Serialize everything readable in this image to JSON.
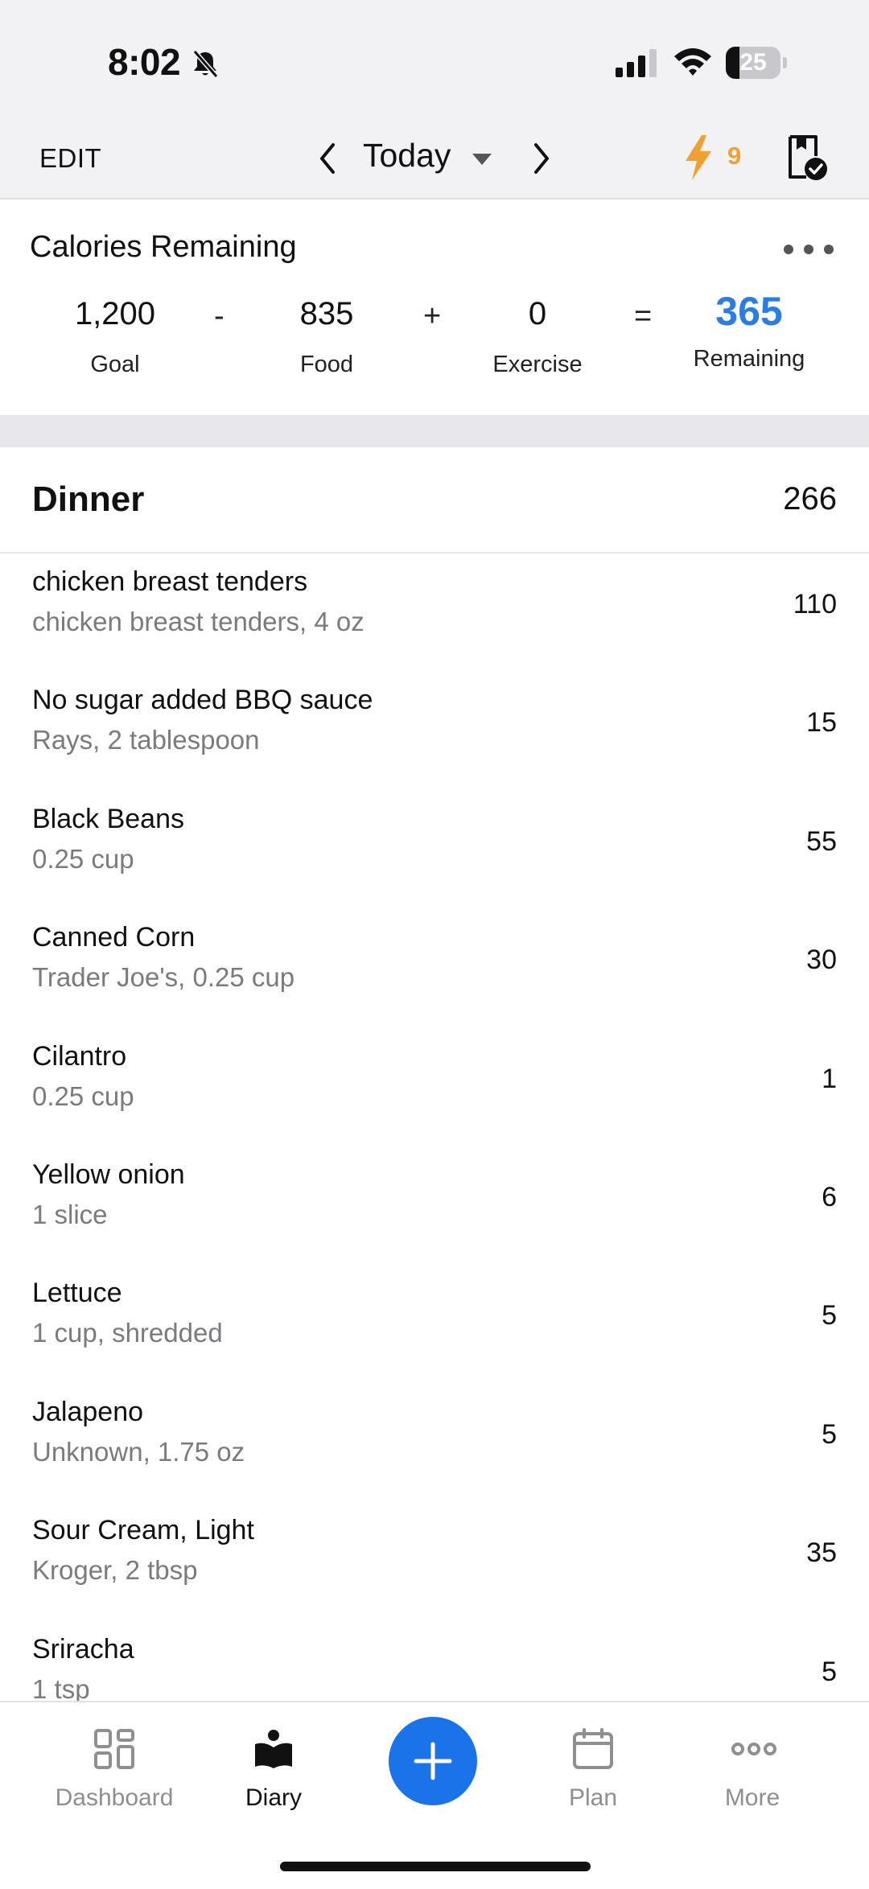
{
  "status_bar": {
    "time": "8:02",
    "battery": "25",
    "battery_fraction": 0.25
  },
  "nav": {
    "edit_label": "EDIT",
    "date_label": "Today",
    "streak_count": "9"
  },
  "calories": {
    "title": "Calories Remaining",
    "goal": "1,200",
    "goal_label": "Goal",
    "minus": "-",
    "food": "835",
    "food_label": "Food",
    "plus": "+",
    "exercise": "0",
    "exercise_label": "Exercise",
    "equals": "=",
    "remaining": "365",
    "remaining_label": "Remaining",
    "remaining_color": "#2a7de1"
  },
  "meal": {
    "name": "Dinner",
    "total": "266",
    "items": [
      {
        "name": "chicken breast tenders",
        "desc": "chicken breast tenders, 4 oz",
        "cals": "110"
      },
      {
        "name": "No sugar added BBQ sauce",
        "desc": "Rays, 2 tablespoon",
        "cals": "15"
      },
      {
        "name": "Black Beans",
        "desc": "0.25 cup",
        "cals": "55"
      },
      {
        "name": "Canned Corn",
        "desc": "Trader Joe's, 0.25 cup",
        "cals": "30"
      },
      {
        "name": "Cilantro",
        "desc": "0.25 cup",
        "cals": "1"
      },
      {
        "name": "Yellow onion",
        "desc": "1 slice",
        "cals": "6"
      },
      {
        "name": "Lettuce",
        "desc": "1 cup, shredded",
        "cals": "5"
      },
      {
        "name": "Jalapeno",
        "desc": "Unknown, 1.75 oz",
        "cals": "5"
      },
      {
        "name": "Sour Cream, Light",
        "desc": "Kroger, 2 tbsp",
        "cals": "35"
      },
      {
        "name": "Sriracha",
        "desc": "1 tsp",
        "cals": "5"
      }
    ]
  },
  "tabs": {
    "dashboard": "Dashboard",
    "diary": "Diary",
    "plan": "Plan",
    "more": "More"
  },
  "colors": {
    "accent": "#1a73e8",
    "streak": "#f0a030"
  }
}
